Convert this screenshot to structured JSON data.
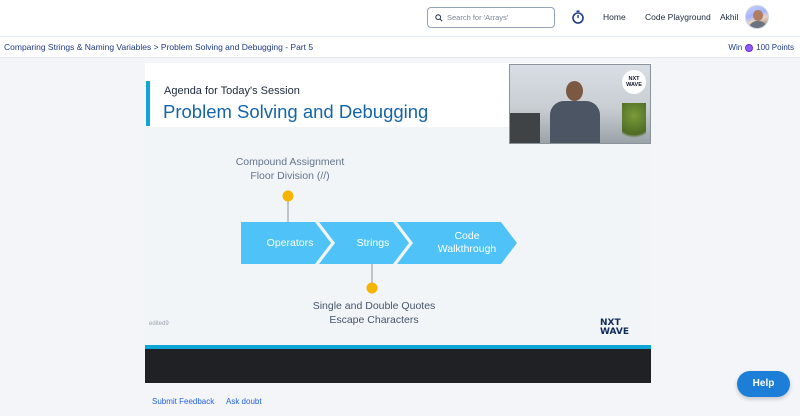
{
  "header": {
    "search_placeholder": "Search for 'Arrays'",
    "nav": {
      "home": "Home",
      "code_playground": "Code Playground"
    },
    "user_name": "Akhil"
  },
  "breadcrumb": "Comparing Strings & Naming Variables > Problem Solving and Debugging - Part 5",
  "rewards": {
    "prefix": "Win",
    "points": "100 Points"
  },
  "slide": {
    "subtitle": "Agenda for Today's Session",
    "title": "Problem Solving and Debugging",
    "top_notes": [
      "Compound Assignment",
      "Floor Division (//)"
    ],
    "steps": [
      "Operators",
      "Strings",
      "Code",
      "Walkthrough"
    ],
    "bottom_notes": [
      "Single and Double Quotes",
      "Escape Characters"
    ],
    "edited_tag": "edited9",
    "logo_line1": "NXT",
    "logo_line2": "WAVE"
  },
  "webcam_logo": {
    "line1": "NXT",
    "line2": "WAVE"
  },
  "footer_links": {
    "submit_feedback": "Submit Feedback",
    "ask_doubt": "Ask doubt"
  },
  "help_label": "Help",
  "colors": {
    "accent": "#0ea5d9",
    "title": "#1565a8",
    "chevron": "#4fc3f7",
    "dot": "#f4b400",
    "help": "#1d7ed8"
  }
}
